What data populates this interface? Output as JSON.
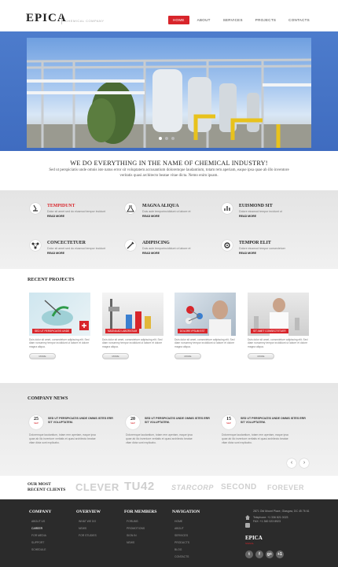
{
  "header": {
    "logo": "EPICA",
    "tagline": "CHEMICAL COMPANY",
    "nav": [
      "HOME",
      "ABOUT",
      "SERVICES",
      "PROJECTS",
      "CONTACTS"
    ]
  },
  "intro": {
    "title": "WE DO EVERYTHING IN THE NAME OF CHEMICAL INDUSTRY!",
    "text": "Sed ut perspiciatis unde omnis iste natus error sit voluptatem accusantium doloremque laudantium, totam rem aperiam, eaque ipsa quae ab illo inventore veritatis quasi architecto beatae vitae dicta. Nemo enim ipsam."
  },
  "features": [
    {
      "title": "TEMPIDUNT",
      "text": "Dolor sit amet sed do eiusmod tempor incidunt",
      "more": "READ MORE",
      "icon": "microscope-icon"
    },
    {
      "title": "MAGNA ALIQUA",
      "text": "Duis aute temporincididunt ut labore et",
      "more": "READ MORE",
      "icon": "flask-icon"
    },
    {
      "title": "EUISMOND SIT",
      "text": "Dolore eiusmod tempor incidunt ut",
      "more": "READ MORE",
      "icon": "chart-icon"
    },
    {
      "title": "CONCECTETUER",
      "text": "Dolor sit amet sed do eiusmod tempor incidunt",
      "more": "READ MORE",
      "icon": "molecule-icon"
    },
    {
      "title": "ADIPISCING",
      "text": "Duis aute temporincididunt ut labore et",
      "more": "READ MORE",
      "icon": "pipette-icon"
    },
    {
      "title": "TEMPOR ELIT",
      "text": "Dolore eiusmod tempor consectetuer",
      "more": "READ MORE",
      "icon": "gear-icon"
    }
  ],
  "projects": {
    "title": "RECENT PROJECTS",
    "items": [
      {
        "caption": "SED UT PERSPICIATIS UNDE",
        "text": "Duis dolor sit amet, consectetuer adipiscing elit. Sed diam nonummy tempor incididunt ut labore et dolore magna aliqua.",
        "button": "MORE"
      },
      {
        "caption": "MAGNA AD LABORATUM",
        "text": "Duis dolor sit amet, consectetuer adipiscing elit. Sed diam nonummy tempor incididunt ut labore et dolore magna aliqua.",
        "button": "MORE"
      },
      {
        "caption": "DOLORE IPSUM EST",
        "text": "Duis dolor sit amet, consectetuer adipiscing elit. Sed diam nonummy tempor incididunt ut labore et dolore magna aliqua.",
        "button": "MORE"
      },
      {
        "caption": "SIT AMET CONSECTETUER",
        "text": "Duis dolor sit amet, consectetuer adipiscing elit. Sed diam nonummy tempor incididunt ut labore et dolore magna aliqua.",
        "button": "MORE"
      }
    ]
  },
  "news": {
    "title": "COMPANY NEWS",
    "items": [
      {
        "day": "25",
        "month": "SEP",
        "title": "SED UT PERSPICIATIS UNDE OMNIS ISTES ERR SIT VOLUPTATEM.",
        "text": "Doloremque laudantium, totam rem aperiam, eaque ipsa quae ab illo inventore veritatis et quasi architecto beatae vitae dicta sunt explicabo."
      },
      {
        "day": "20",
        "month": "SEP",
        "title": "SED UT PERSPICIATIS UNDE OMNIS ISTES ERR SIT VOLUPTATEM.",
        "text": "Doloremque laudantium, totam rem aperiam, eaque ipsa quae ab illo inventore veritatis et quasi architecto beatae vitae dicta sunt explicabo."
      },
      {
        "day": "15",
        "month": "SEP",
        "title": "SED UT PERSPICIATIS UNDE OMNIS ISTES ERR SIT VOLUPTATEM.",
        "text": "Doloremque laudantium, totam rem aperiam, eaque ipsa quae ab illo inventore veritatis et quasi architecto beatae vitae dicta sunt explicabo."
      }
    ],
    "prev": "‹",
    "next": "›"
  },
  "clients": {
    "title_line1": "OUR MOST",
    "title_line2": "RECENT CLIENTS",
    "names": [
      "CLEVER",
      "TU42",
      "STARCORP",
      "SECOND",
      "FOREVER"
    ]
  },
  "footer": {
    "columns": [
      {
        "title": "COMPANY",
        "links": [
          "ABOUT US",
          "CAREER",
          "FOR MEDIA",
          "SUPPORT",
          "SCHEDULE"
        ],
        "highlight": 1
      },
      {
        "title": "OVERVIEW",
        "links": [
          "WHAT WE DO",
          "NEWS",
          "FOR STUDIES"
        ],
        "highlight": -1
      },
      {
        "title": "FOR MEMBERS",
        "links": [
          "FORUMS",
          "PROMOTIONS",
          "SIGN IN",
          "NEWS"
        ],
        "highlight": -1
      },
      {
        "title": "NAVIGATION",
        "links": [
          "HOME",
          "ABOUT",
          "SERVICES",
          "PRODUCTS",
          "BLOG",
          "CONTACTS"
        ],
        "highlight": -1
      }
    ],
    "address": "2871 Old Mount Place, Glasgow, DC 45 76 61",
    "phone": "Telephone: +1 336 821 0023",
    "fax": "FAX: +1 360 023 8923",
    "logo": "EPICA",
    "logo_sub": "SIGNAL",
    "social": [
      "t",
      "f",
      "g+",
      "+1"
    ]
  }
}
